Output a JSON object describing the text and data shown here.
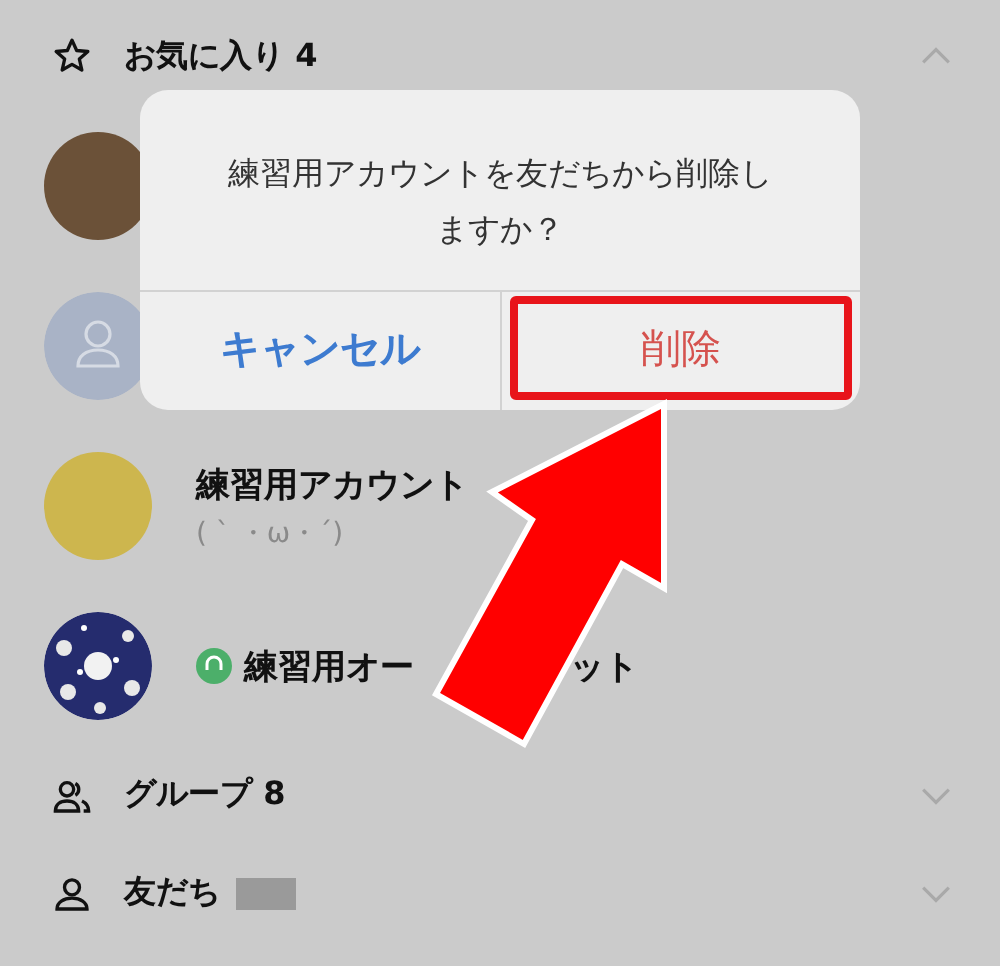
{
  "sections": [
    {
      "kind": "favorites",
      "label": "お気に入り 4",
      "expanded": true,
      "items": [
        {
          "kind": "avatar",
          "color": "#6b5138"
        },
        {
          "kind": "default_avatar"
        },
        {
          "kind": "avatar",
          "color": "#cdb64e",
          "name": "練習用アカウント",
          "status": "( ˋ ・ω・ˊ)"
        },
        {
          "kind": "picture",
          "open_chat": true,
          "name_parts": [
            "練習用オー",
            "ット"
          ]
        }
      ]
    },
    {
      "kind": "groups",
      "label": "グループ 8",
      "expanded": false
    },
    {
      "kind": "friends",
      "label": "友だち",
      "expanded": false,
      "count_hidden": true
    }
  ],
  "dialog": {
    "message": "練習用アカウントを友だちから削除しますか？",
    "buttons": [
      {
        "label": "キャンセル",
        "kind": "cancel",
        "highlighted": false
      },
      {
        "label": "削除",
        "kind": "destructive",
        "highlighted": true
      }
    ]
  },
  "annotation": {
    "kind": "arrow"
  }
}
